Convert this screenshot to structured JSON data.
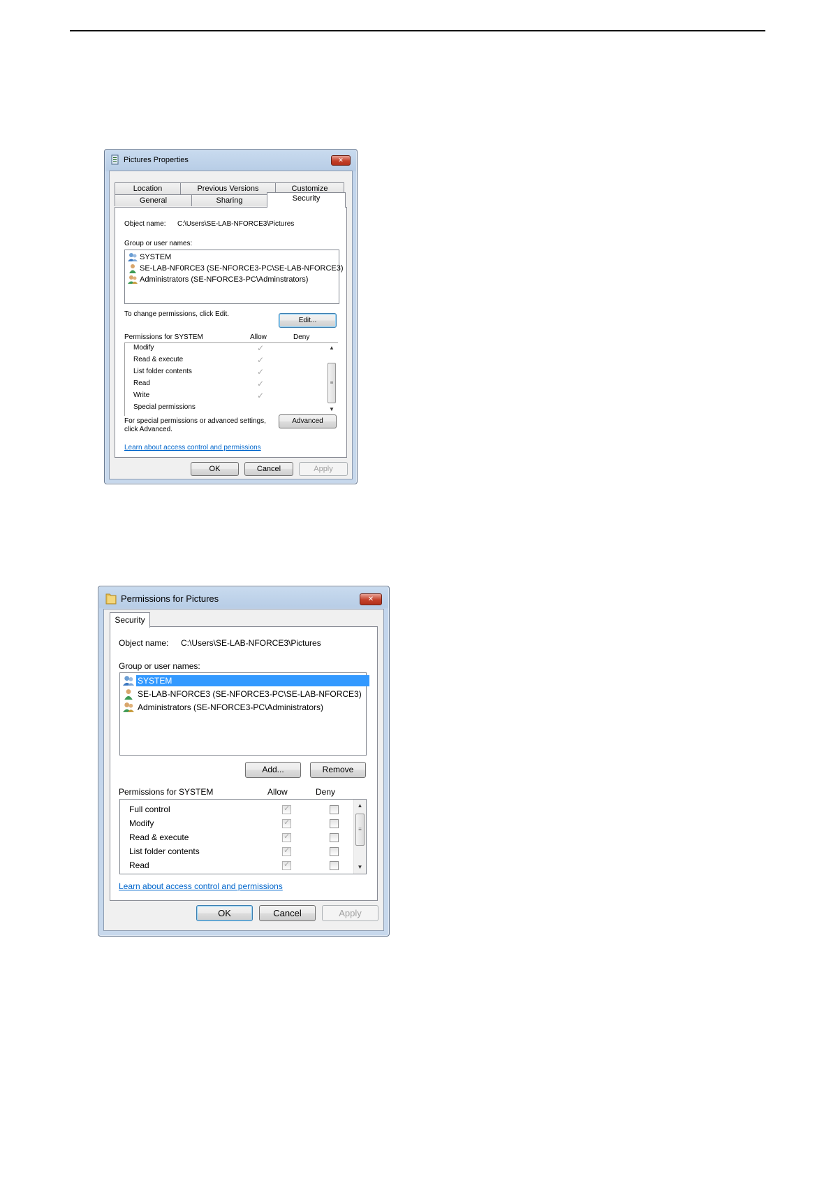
{
  "dialog1": {
    "title": "Pictures Properties",
    "close_label": "✕",
    "tabs_row1": [
      "Location",
      "Previous Versions",
      "Customize"
    ],
    "tabs_row2": [
      "General",
      "Sharing",
      "Security"
    ],
    "object_name_label": "Object name:",
    "object_name_value": "C:\\Users\\SE-LAB-NFORCE3\\Pictures",
    "group_label": "Group or user names:",
    "users": [
      {
        "name": "SYSTEM",
        "icon": "group-users-icon"
      },
      {
        "name": "SE-LAB-NF0RCE3 (SE-NFORCE3-PC\\SE-LAB-NFORCE3)",
        "icon": "user-icon"
      },
      {
        "name": "Administrators (SE-NFORCE3-PC\\Adminstrators)",
        "icon": "admin-group-icon"
      }
    ],
    "change_text": "To change permissions, click Edit.",
    "edit_button": "Edit...",
    "permissions_label": "Permissions for SYSTEM",
    "allow_label": "Allow",
    "deny_label": "Deny",
    "permissions": [
      {
        "name": "Modify",
        "allow": true,
        "deny": false
      },
      {
        "name": "Read & execute",
        "allow": true,
        "deny": false
      },
      {
        "name": "List folder contents",
        "allow": true,
        "deny": false
      },
      {
        "name": "Read",
        "allow": true,
        "deny": false
      },
      {
        "name": "Write",
        "allow": true,
        "deny": false
      },
      {
        "name": "Special permissions",
        "allow": false,
        "deny": false
      }
    ],
    "special_text_1": "For special permissions or advanced settings,",
    "special_text_2": "click Advanced.",
    "advanced_button": "Advanced",
    "link": "Learn about access control and permissions",
    "ok_button": "OK",
    "cancel_button": "Cancel",
    "apply_button": "Apply"
  },
  "dialog2": {
    "title": "Permissions for Pictures",
    "close_label": "✕",
    "tab": "Security",
    "object_name_label": "Object name:",
    "object_name_value": "C:\\Users\\SE-LAB-NFORCE3\\Pictures",
    "group_label": "Group or user names:",
    "users": [
      {
        "name": "SYSTEM",
        "icon": "group-users-icon",
        "selected": true
      },
      {
        "name": "SE-LAB-NFORCE3 (SE-NFORCE3-PC\\SE-LAB-NFORCE3)",
        "icon": "user-icon",
        "selected": false
      },
      {
        "name": "Administrators (SE-NFORCE3-PC\\Administrators)",
        "icon": "admin-group-icon",
        "selected": false
      }
    ],
    "add_button": "Add...",
    "remove_button": "Remove",
    "permissions_label": "Permissions for SYSTEM",
    "allow_label": "Allow",
    "deny_label": "Deny",
    "permissions": [
      {
        "name": "Full control",
        "allow": true,
        "deny": false
      },
      {
        "name": "Modify",
        "allow": true,
        "deny": false
      },
      {
        "name": "Read & execute",
        "allow": true,
        "deny": false
      },
      {
        "name": "List folder contents",
        "allow": true,
        "deny": false
      },
      {
        "name": "Read",
        "allow": true,
        "deny": false
      }
    ],
    "link": "Learn about access control and permissions",
    "ok_button": "OK",
    "cancel_button": "Cancel",
    "apply_button": "Apply"
  }
}
